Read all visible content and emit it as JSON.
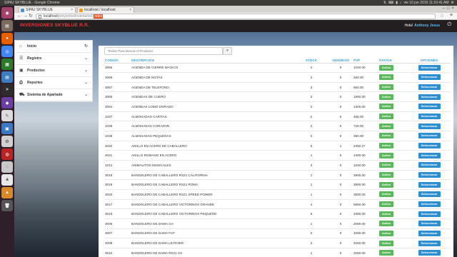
{
  "os": {
    "window_title": "SIPAJ SKYBLUE - Google Chrome",
    "clock": "vie 10 jun 2016 11:10:41 AM"
  },
  "browser": {
    "tabs": [
      {
        "label": "SIPAJ SKYBLUE"
      },
      {
        "label": "localhost / localhost"
      }
    ],
    "url_host": "localhost",
    "url_path": "/proyectos/inventario/Ir",
    "url_highlight": "ndex"
  },
  "app": {
    "brand": "INVERSIONES SKYBLUE R.R.",
    "greeting": "Hola!",
    "user_name": "Anthony Jesus",
    "menu": [
      {
        "label": "Inicio",
        "icon": "home-icon"
      },
      {
        "label": "Registro",
        "icon": "list-icon"
      },
      {
        "label": "Productos",
        "icon": "box-icon"
      },
      {
        "label": "Reportes",
        "icon": "print-icon"
      },
      {
        "label": "Sistema de Apartado",
        "icon": "cart-icon"
      }
    ],
    "search_placeholder": "Teclee Para Buscar el Producto",
    "columns": {
      "code": "CODIGO",
      "desc": "DESCRIPCIÓN",
      "stock": "STOCK",
      "sold": "VENDIDOS",
      "pvp": "PVP",
      "status": "STATUS",
      "ops": "OPCIONES"
    },
    "rows": [
      {
        "code": "3066",
        "desc": "AGENDA DE CIERRE MAGICO",
        "stock": "2",
        "sold": "0",
        "pvp": "1040.00",
        "status": "Activo",
        "op": "Seleccionar"
      },
      {
        "code": "3068",
        "desc": "AGENDA DE NOTAS",
        "stock": "2",
        "sold": "0",
        "pvp": "260.00",
        "status": "Activo",
        "op": "Seleccionar"
      },
      {
        "code": "3067",
        "desc": "AGENDA DE TELEFONO",
        "stock": "3",
        "sold": "0",
        "pvp": "650.00",
        "status": "Activo",
        "op": "Seleccionar"
      },
      {
        "code": "3065",
        "desc": "AGENDAS DE CUERO",
        "stock": "2",
        "sold": "0",
        "pvp": "1950.00",
        "status": "Activo",
        "op": "Seleccionar"
      },
      {
        "code": "3064",
        "desc": "AGENDAS LOMO DORADO",
        "stock": "2",
        "sold": "0",
        "pvp": "1300.00",
        "status": "Activo",
        "op": "Seleccionar"
      },
      {
        "code": "1037",
        "desc": "ALMOHADAS CARITAS",
        "stock": "2",
        "sold": "0",
        "pvp": "468.00",
        "status": "Activo",
        "op": "Seleccionar"
      },
      {
        "code": "1039",
        "desc": "ALMOHADAS CORAZON",
        "stock": "2",
        "sold": "0",
        "pvp": "728.00",
        "status": "Activo",
        "op": "Seleccionar"
      },
      {
        "code": "1038",
        "desc": "ALMOHADAS PEQUEÑAS",
        "stock": "2",
        "sold": "0",
        "pvp": "390.00",
        "status": "Activo",
        "op": "Seleccionar"
      },
      {
        "code": "4032",
        "desc": "ANILLO EN ACERO DE CABALLERO",
        "stock": "5",
        "sold": "1",
        "pvp": "2250.27",
        "status": "Activo",
        "op": "Seleccionar"
      },
      {
        "code": "4031",
        "desc": "ANILLO ROMANO EN ACERO",
        "stock": "1",
        "sold": "0",
        "pvp": "1300.00",
        "status": "Activo",
        "op": "Seleccionar"
      },
      {
        "code": "1014",
        "desc": "ANIMALITOS MUSICALES",
        "stock": "3",
        "sold": "0",
        "pvp": "1040.00",
        "status": "Activo",
        "op": "Seleccionar"
      },
      {
        "code": "3018",
        "desc": "BANDOLERO DE CABALLERO RS21 CALIFORNIA",
        "stock": "1",
        "sold": "0",
        "pvp": "3900.00",
        "status": "Activo",
        "op": "Seleccionar"
      },
      {
        "code": "3019",
        "desc": "BANDOLERO DE CABALLERO RS21 ROMA",
        "stock": "1",
        "sold": "0",
        "pvp": "3900.00",
        "status": "Activo",
        "op": "Seleccionar"
      },
      {
        "code": "3020",
        "desc": "BANDOLERO DE CABALLERO RS21 SPEED POWER",
        "stock": "1",
        "sold": "0",
        "pvp": "3900.00",
        "status": "Activo",
        "op": "Seleccionar"
      },
      {
        "code": "3017",
        "desc": "BANDOLERO DE CABALLERO VICTORINOX GRANDE",
        "stock": "4",
        "sold": "2",
        "pvp": "5850.00",
        "status": "Activo",
        "op": "Seleccionar"
      },
      {
        "code": "3016",
        "desc": "BANDOLERO DE CABALLERO VICTORINOX PEQUEÑO",
        "stock": "5",
        "sold": "0",
        "pvp": "3380.00",
        "status": "Activo",
        "op": "Seleccionar"
      },
      {
        "code": "3006",
        "desc": "BANDOLERO DE DAMA CH",
        "stock": "1",
        "sold": "0",
        "pvp": "2080.00",
        "status": "Activo",
        "op": "Seleccionar"
      },
      {
        "code": "3007",
        "desc": "BANDOLERO DE DAMA FCF",
        "stock": "2",
        "sold": "0",
        "pvp": "3250.00",
        "status": "Activo",
        "op": "Seleccionar"
      },
      {
        "code": "3008",
        "desc": "BANDOLERO DE DAMA LEATHER",
        "stock": "2",
        "sold": "0",
        "pvp": "3250.00",
        "status": "Activo",
        "op": "Seleccionar"
      },
      {
        "code": "3010",
        "desc": "BANDOLERO DE DAMA RS21 CH",
        "stock": "1",
        "sold": "0",
        "pvp": "3250.00",
        "status": "Activo",
        "op": "Seleccionar"
      }
    ]
  }
}
